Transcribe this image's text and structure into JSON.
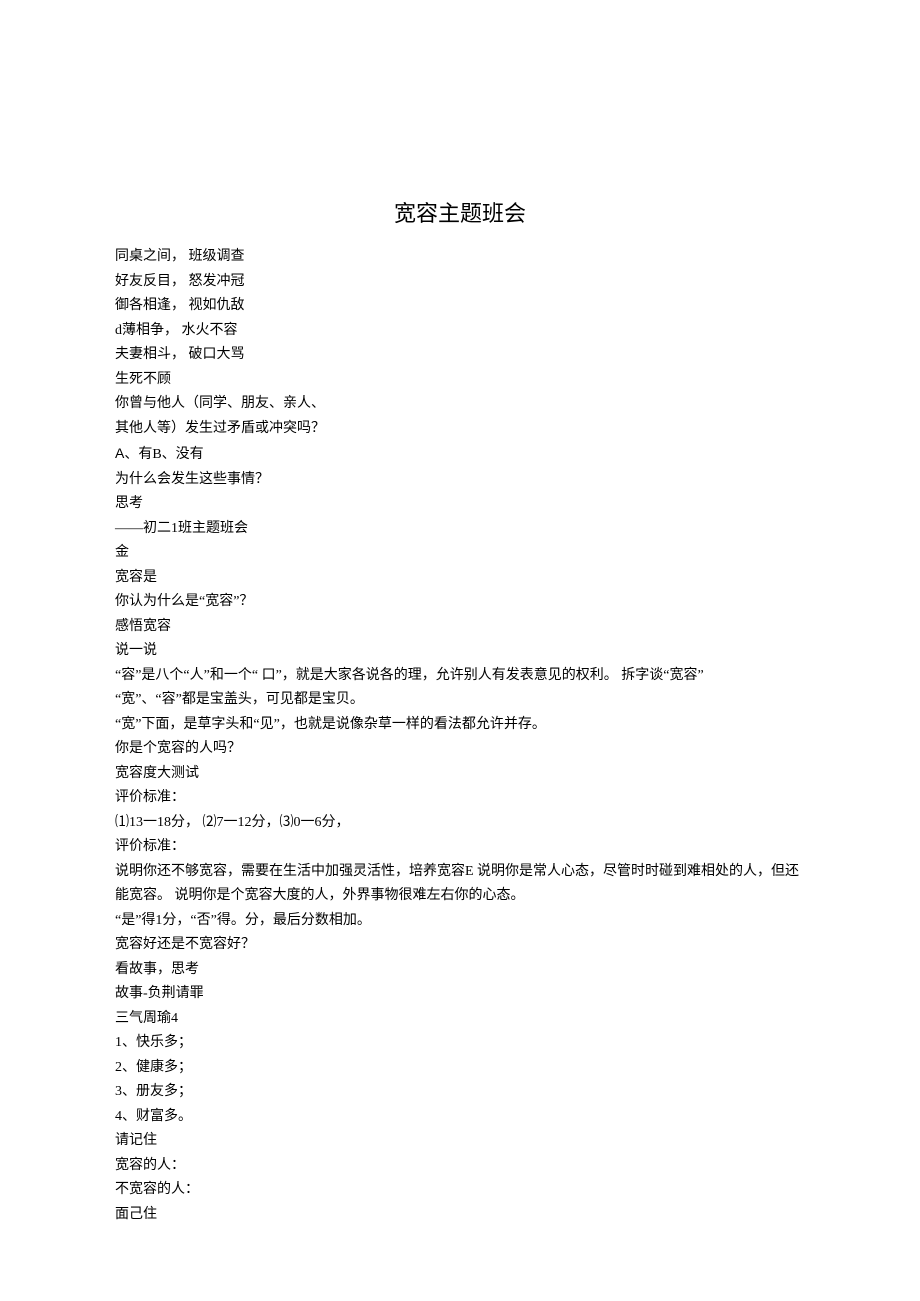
{
  "title": "宽容主题班会",
  "lines": [
    "同桌之间，  班级调查",
    "好友反目，  怒发冲冠",
    "御各相逢，  视如仇敌",
    "d薄相争，   水火不容",
    "夫妻相斗，  破口大骂"
  ],
  "indentedLine": "生死不顾",
  "pre2": [
    "你曾与他人（同学、朋友、亲人、",
    "其他人等）发生过矛盾或冲突吗？"
  ],
  "mixedPrefix": "A",
  "mixedSuffix": "、有B、没有",
  "body": [
    "为什么会发生这些事情？",
    "思考",
    "——初二1班主题班会",
    "金",
    "宽容是",
    "你认为什么是“宽容”？",
    "感悟宽容",
    "说一说",
    "“容”是八个“人”和一个“ 口”，就是大家各说各的理，允许别人有发表意见的权利。 拆字谈“宽容”",
    "“宽”、“容”都是宝盖头，可见都是宝贝。",
    "“宽”下面，是草字头和“见”，也就是说像杂草一样的看法都允许并存。",
    "你是个宽容的人吗？",
    "宽容度大测试",
    "评价标准：",
    "⑴13一18分， ⑵7一12分，⑶0一6分，",
    "评价标准：",
    "说明你还不够宽容，需要在生活中加强灵活性，培养宽容E 说明你是常人心态，尽管时时碰到难相处的人，但还能宽容。 说明你是个宽容大度的人，外界事物很难左右你的心态。",
    "“是”得1分，“否”得。分，最后分数相加。",
    "宽容好还是不宽容好？",
    "看故事，思考",
    "故事-负荆请罪",
    "三气周瑜4",
    "1、快乐多；",
    "2、健康多；",
    "3、册友多；",
    "4、财富多。",
    "请记住",
    "宽容的人：",
    "不宽容的人：",
    "面己住"
  ]
}
